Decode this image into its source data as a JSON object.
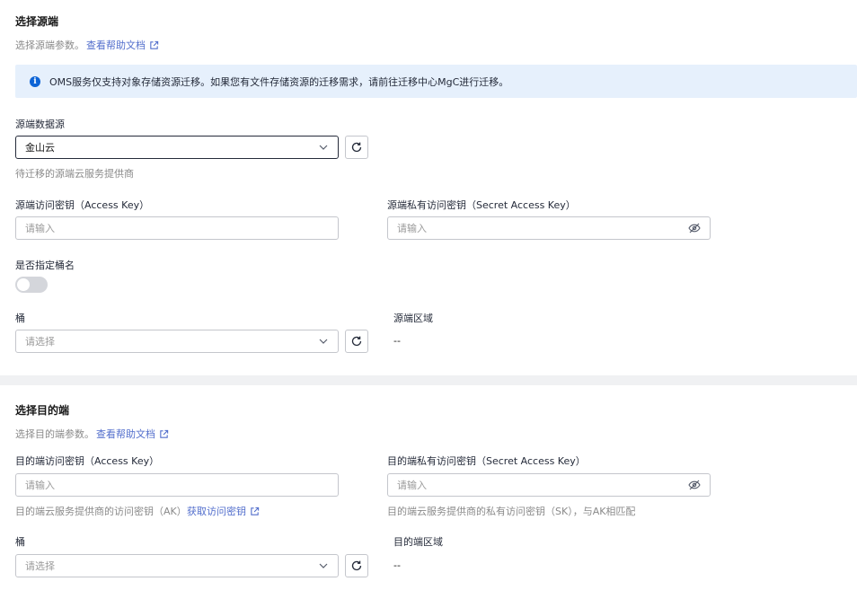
{
  "source": {
    "title": "选择源端",
    "desc": "选择源端参数。",
    "help_link": "查看帮助文档",
    "banner": "OMS服务仅支持对象存储资源迁移。如果您有文件存储资源的迁移需求，请前往迁移中心MgC进行迁移。",
    "datasource_label": "源端数据源",
    "datasource_value": "金山云",
    "datasource_hint": "待迁移的源端云服务提供商",
    "ak_label": "源端访问密钥（Access Key）",
    "ak_placeholder": "请输入",
    "sk_label": "源端私有访问密钥（Secret Access Key）",
    "sk_placeholder": "请输入",
    "bucket_toggle_label": "是否指定桶名",
    "bucket_toggle_on": false,
    "bucket_label": "桶",
    "bucket_placeholder": "请选择",
    "region_label": "源端区域",
    "region_value": "--"
  },
  "destination": {
    "title": "选择目的端",
    "desc": "选择目的端参数。",
    "help_link": "查看帮助文档",
    "ak_label": "目的端访问密钥（Access Key）",
    "ak_placeholder": "请输入",
    "ak_hint": "目的端云服务提供商的访问密钥（AK）",
    "ak_link": "获取访问密钥",
    "sk_label": "目的端私有访问密钥（Secret Access Key）",
    "sk_placeholder": "请输入",
    "sk_hint": "目的端云服务提供商的私有访问密钥（SK），与AK相匹配",
    "bucket_label": "桶",
    "bucket_placeholder": "请选择",
    "region_label": "目的端区域",
    "region_value": "--"
  },
  "icons": {
    "info": "info-icon",
    "external": "external-link-icon",
    "chevron": "chevron-down-icon",
    "refresh": "refresh-icon",
    "eye": "eye-off-icon"
  },
  "colors": {
    "link": "#526ecc",
    "banner_bg": "#e6f0fc",
    "info_blue": "#0d64d6",
    "divider": "#f0f1f3"
  }
}
